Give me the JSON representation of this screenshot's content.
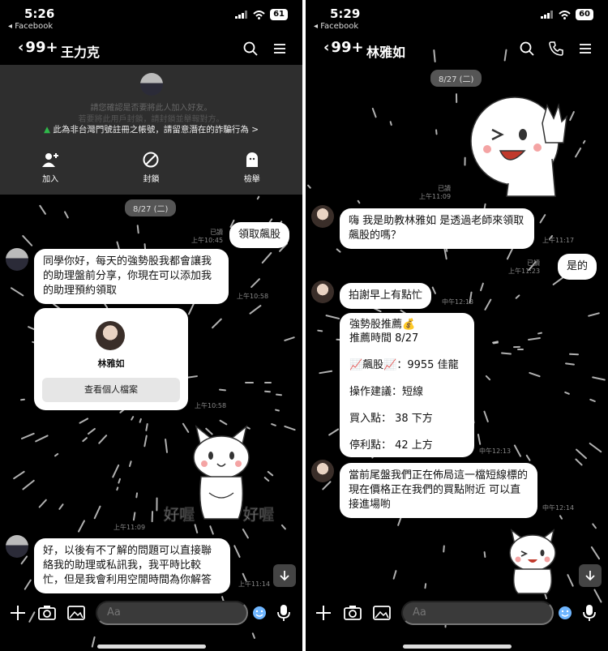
{
  "left": {
    "status": {
      "time": "5:26",
      "back_app": "◂ Facebook",
      "battery": "61"
    },
    "nav": {
      "back_count": "99+",
      "name": "王力克"
    },
    "warning": {
      "line1": "請您確認是否要將此人加入好友。",
      "line2": "若要將此用戶封鎖，請封鎖並舉報對方。",
      "line3": "此為非台灣門號註冊之帳號，請留意潛在的詐騙行為 >",
      "actions": [
        {
          "label": "加入",
          "icon": "add-friend-icon"
        },
        {
          "label": "封鎖",
          "icon": "block-icon"
        },
        {
          "label": "檢舉",
          "icon": "report-icon"
        }
      ]
    },
    "date": "8/27 (二)",
    "messages": {
      "out1": {
        "text": "領取飆股",
        "read": "已讀",
        "time": "上午10:45"
      },
      "in1": {
        "text": "同學你好，每天的強勢股我都會讓我的助理盤前分享，你現在可以添加我的助理預約領取",
        "time": "上午10:58"
      },
      "card": {
        "name": "林雅如",
        "button": "查看個人檔案",
        "time": "上午10:58"
      },
      "sticker": {
        "caption_left": "好喔",
        "caption_right": "好喔",
        "time": "上午11:09"
      },
      "in2": {
        "text": "好，以後有不了解的問題可以直接聯絡我的助理或私訊我，我平時比較忙，但是我會利用空閒時間為你解答",
        "time": "上午11:14"
      }
    },
    "input_placeholder": "Aa"
  },
  "right": {
    "status": {
      "time": "5:29",
      "back_app": "◂ Facebook",
      "battery": "60"
    },
    "nav": {
      "back_count": "99+",
      "name": "林雅如"
    },
    "date": "8/27 (二)",
    "messages": {
      "sticker1": {
        "read": "已讀",
        "time": "上午11:09"
      },
      "in1": {
        "text": "嗨 我是助教林雅如  是透過老師來領取飆股的嗎？",
        "time": "上午11:17"
      },
      "out1": {
        "text": "是的",
        "read": "已讀",
        "time": "上午11:23"
      },
      "in2": {
        "text": "拍謝早上有點忙",
        "time": "中午12:13"
      },
      "in3": {
        "line1": "強勢股推薦💰",
        "line2": "推薦時間 8/27",
        "line3": "📈飆股📈：9955 佳龍",
        "line4": "操作建議：短線",
        "line5": "買入點：  38 下方",
        "line6": "停利點：  42 上方",
        "time": "中午12:13"
      },
      "in4": {
        "text": "當前尾盤我們正在佈局這一檔短線標的  現在價格正在我們的買點附近  可以直接進場喲",
        "time": "中午12:14"
      }
    },
    "input_placeholder": "Aa"
  },
  "colors": {
    "background": "#000000",
    "bubble": "#ffffff",
    "panel": "#2e2e2e",
    "warning": "#2fb94a"
  }
}
